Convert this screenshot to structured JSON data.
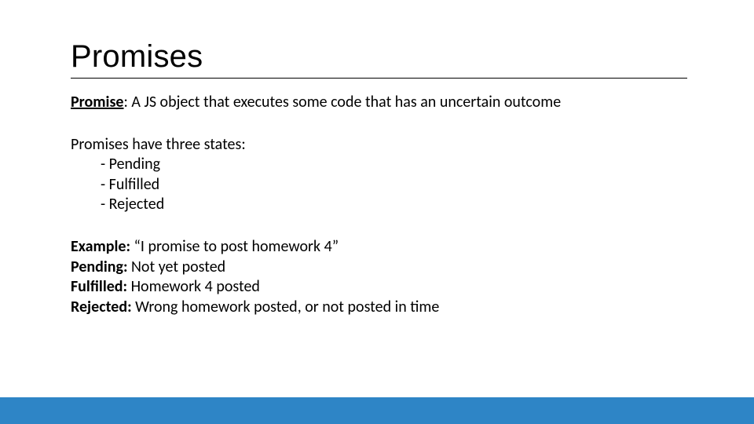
{
  "title": "Promises",
  "definition": {
    "label": "Promise",
    "text": ": A JS object that executes some code that has an uncertain outcome"
  },
  "states": {
    "intro": "Promises have three states:",
    "items": [
      "- Pending",
      "- Fulfilled",
      "- Rejected"
    ]
  },
  "example": {
    "label": "Example:",
    "text": " “I promise to post homework 4”",
    "pending_label": "Pending:",
    "pending_text": " Not yet posted",
    "fulfilled_label": "Fulfilled:",
    "fulfilled_text": " Homework 4 posted",
    "rejected_label": "Rejected:",
    "rejected_text": " Wrong homework posted, or not posted in time"
  }
}
